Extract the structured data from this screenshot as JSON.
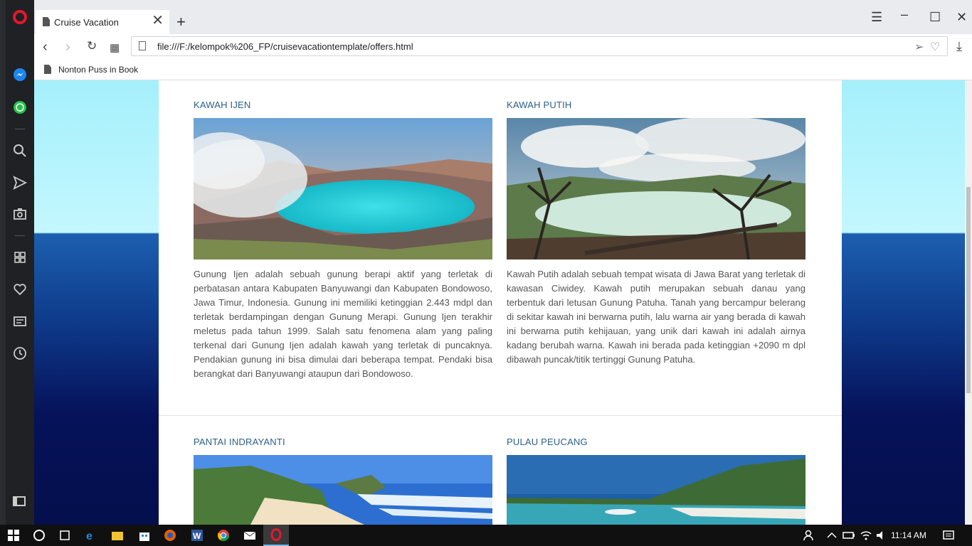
{
  "browser": {
    "tab_title": "Cruise Vacation",
    "tab_close": "✕",
    "new_tab": "+",
    "url": "file:///F:/kelompok%206_FP/cruisevacationtemplate/offers.html",
    "bookmark": "Nonton Puss in Book"
  },
  "sidebar_icons": [
    "messenger-icon",
    "whatsapp-icon",
    "search-icon",
    "send-icon",
    "camera-icon",
    "speed-dial-icon",
    "heart-icon",
    "news-icon",
    "history-icon"
  ],
  "page": {
    "items": [
      {
        "title": "KAWAH IJEN",
        "text": "Gunung Ijen adalah sebuah gunung berapi aktif yang terletak di perbatasan antara Kabupaten Banyuwangi dan Kabupaten Bondowoso, Jawa Timur, Indonesia. Gunung ini memiliki ketinggian 2.443 mdpl dan terletak berdampingan dengan Gunung Merapi. Gunung Ijen terakhir meletus pada tahun 1999. Salah satu fenomena alam yang paling terkenal dari Gunung Ijen adalah kawah yang terletak di puncaknya. Pendakian gunung ini bisa dimulai dari beberapa tempat. Pendaki bisa berangkat dari Banyuwangi ataupun dari Bondowoso."
      },
      {
        "title": "KAWAH PUTIH",
        "text": "Kawah Putih adalah sebuah tempat wisata di Jawa Barat yang terletak di kawasan Ciwidey. Kawah putih merupakan sebuah danau yang terbentuk dari letusan Gunung Patuha. Tanah yang bercampur belerang di sekitar kawah ini berwarna putih, lalu warna air yang berada di kawah ini berwarna putih kehijauan, yang unik dari kawah ini adalah airnya kadang berubah warna. Kawah ini berada pada ketinggian +2090 m dpl dibawah puncak/titik tertinggi Gunung Patuha."
      },
      {
        "title": "PANTAI INDRAYANTI"
      },
      {
        "title": "PULAU PEUCANG"
      }
    ]
  },
  "taskbar": {
    "time": "11:14 AM"
  },
  "colors": {
    "heading": "#2c5f8a",
    "opera_red": "#e3182d"
  }
}
